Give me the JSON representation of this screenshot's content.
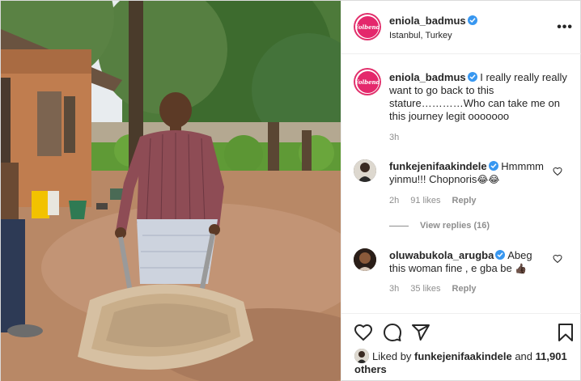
{
  "header": {
    "avatar_logo_text": "Yolbend",
    "username": "eniola_badmus",
    "location": "Istanbul, Turkey",
    "more_label": "•••"
  },
  "caption": {
    "username": "eniola_badmus",
    "text": "I really really really want to go back to this stature…………Who can take me on this journey legit ooooooo",
    "time": "3h"
  },
  "comments": [
    {
      "username": "funkejenifaakindele",
      "text": "Hmmmm yinmu!!! Chopnoris",
      "emoji": "😂😂",
      "time": "2h",
      "likes": "91 likes",
      "reply": "Reply"
    },
    {
      "username": "oluwabukola_arugba",
      "text": "Abeg this woman fine , e gba be",
      "emoji": "👍🏿",
      "time": "3h",
      "likes": "35 likes",
      "reply": "Reply"
    }
  ],
  "view_replies": "View replies (16)",
  "liked_by": {
    "prefix": "Liked by",
    "user": "funkejenifaakindele",
    "and": "and",
    "others": "11,901 others"
  },
  "icons": {
    "like": "heart-icon",
    "comment": "comment-icon",
    "share": "share-icon",
    "save": "bookmark-icon",
    "more": "more-icon",
    "verified": "verified-badge-icon"
  },
  "colors": {
    "accent": "#e1306c",
    "verified": "#3897f0",
    "text": "#262626",
    "muted": "#8e8e8e"
  }
}
